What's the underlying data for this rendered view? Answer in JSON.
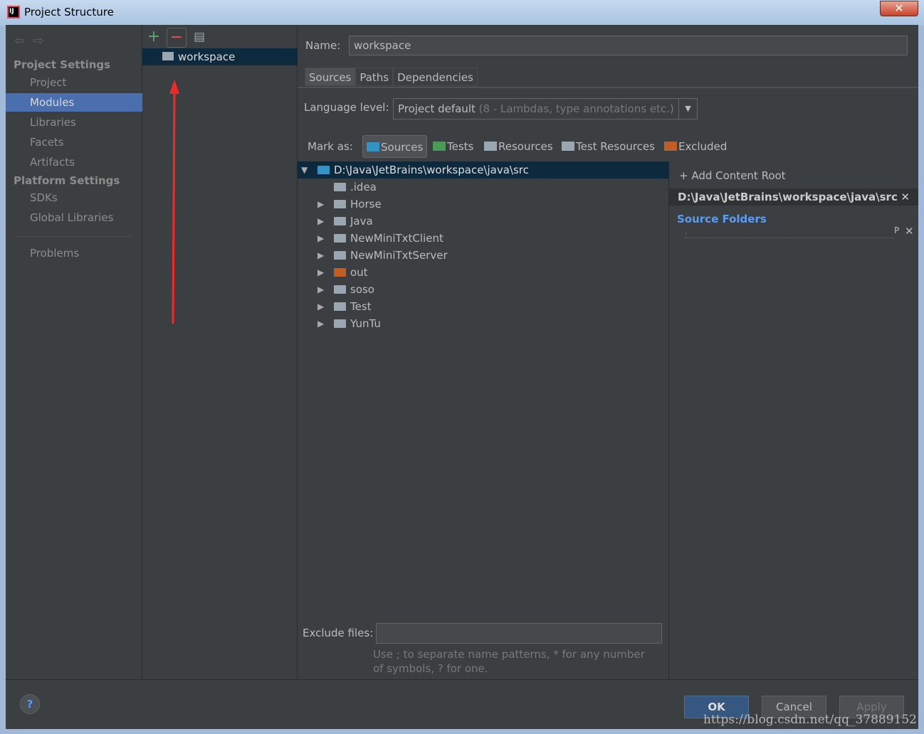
{
  "window": {
    "title": "Project Structure",
    "close": "✕"
  },
  "sidebar": {
    "sections": [
      {
        "label": "Project Settings"
      },
      {
        "label": "Platform Settings"
      }
    ],
    "items": [
      {
        "label": "Project"
      },
      {
        "label": "Modules",
        "selected": true
      },
      {
        "label": "Libraries"
      },
      {
        "label": "Facets"
      },
      {
        "label": "Artifacts"
      },
      {
        "label": "SDKs"
      },
      {
        "label": "Global Libraries"
      },
      {
        "label": "Problems"
      }
    ]
  },
  "modules": {
    "items": [
      {
        "label": "workspace"
      }
    ]
  },
  "main": {
    "name_label": "Name:",
    "name_value": "workspace",
    "tabs": [
      {
        "label": "Sources",
        "selected": true
      },
      {
        "label": "Paths"
      },
      {
        "label": "Dependencies"
      }
    ],
    "language_label": "Language level:",
    "language_value": "Project default",
    "language_hint": "(8 - Lambdas, type annotations etc.)",
    "mark_as_label": "Mark as:",
    "mark_buttons": [
      {
        "label": "Sources",
        "color": "#3592c4"
      },
      {
        "label": "Tests",
        "color": "#499c54"
      },
      {
        "label": "Resources",
        "color": "#9aa7b0"
      },
      {
        "label": "Test Resources",
        "color": "#9aa7b0"
      },
      {
        "label": "Excluded",
        "color": "#c25d28"
      }
    ],
    "tree": {
      "root": "D:\\Java\\JetBrains\\workspace\\java\\src",
      "children": [
        ".idea",
        "Horse",
        "Java",
        "NewMiniTxtClient",
        "NewMiniTxtServer",
        "out",
        "soso",
        "Test",
        "YunTu"
      ]
    },
    "exclude_label": "Exclude files:",
    "exclude_value": "",
    "exclude_hint": "Use ; to separate name patterns, * for any number of symbols, ? for one.",
    "content_root": {
      "add_label": "Add Content Root",
      "path": "D:\\Java\\JetBrains\\workspace\\java\\src",
      "source_folders_label": "Source Folders",
      "source_entry": "."
    }
  },
  "footer": {
    "help": "?",
    "ok": "OK",
    "cancel": "Cancel",
    "apply": "Apply"
  },
  "watermark": "https://blog.csdn.net/qq_37889152"
}
